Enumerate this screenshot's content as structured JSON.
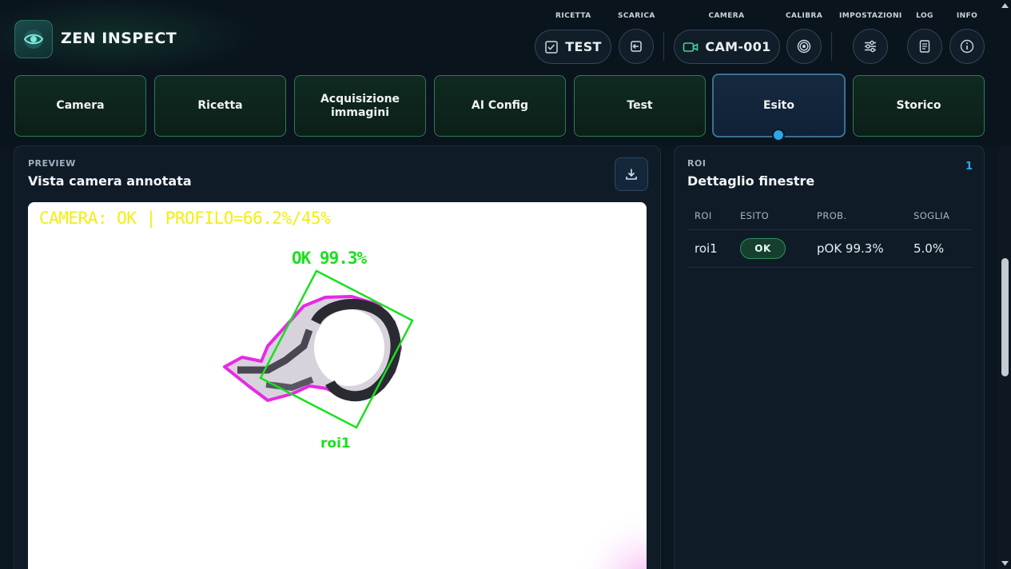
{
  "app": {
    "brand": "ZEN INSPECT",
    "logo_icon": "eye-icon"
  },
  "toolbar": {
    "labels": {
      "ricetta": "RICETTA",
      "scarica": "SCARICA",
      "camera": "CAMERA",
      "calibra": "CALIBRA",
      "impostazioni": "IMPOSTAZIONI",
      "log": "LOG",
      "info": "INFO"
    },
    "recipe_value": "TEST",
    "camera_value": "CAM-001",
    "icons": {
      "ricetta": "checklist-icon",
      "scarica": "export-icon",
      "camera": "video-camera-icon",
      "calibra": "target-icon",
      "impostazioni": "sliders-icon",
      "log": "document-icon",
      "info": "info-icon"
    }
  },
  "tabs": [
    {
      "label": "Camera"
    },
    {
      "label": "Ricetta"
    },
    {
      "label": "Acquisizione immagini"
    },
    {
      "label": "AI Config"
    },
    {
      "label": "Test"
    },
    {
      "label": "Esito",
      "active": true
    },
    {
      "label": "Storico"
    }
  ],
  "preview": {
    "kicker": "PREVIEW",
    "title": "Vista camera annotata",
    "download_icon": "download-icon",
    "overlay_status": "CAMERA: OK | PROFILO=66.2%/45%",
    "detection_label": "OK 99.3%",
    "roi_label": "roi1"
  },
  "roi_panel": {
    "kicker": "ROI",
    "title": "Dettaglio finestre",
    "count": "1",
    "columns": [
      "ROI",
      "ESITO",
      "PROB.",
      "SOGLIA"
    ],
    "rows": [
      {
        "roi": "roi1",
        "esito": "OK",
        "prob": "pOK 99.3%",
        "soglia": "5.0%"
      }
    ]
  },
  "colors": {
    "accent_green": "#2f7a55",
    "accent_blue": "#2ea8ef",
    "overlay_yellow": "#f2ee12",
    "overlay_green": "#19e01e",
    "contour_magenta": "#e62ae6"
  }
}
